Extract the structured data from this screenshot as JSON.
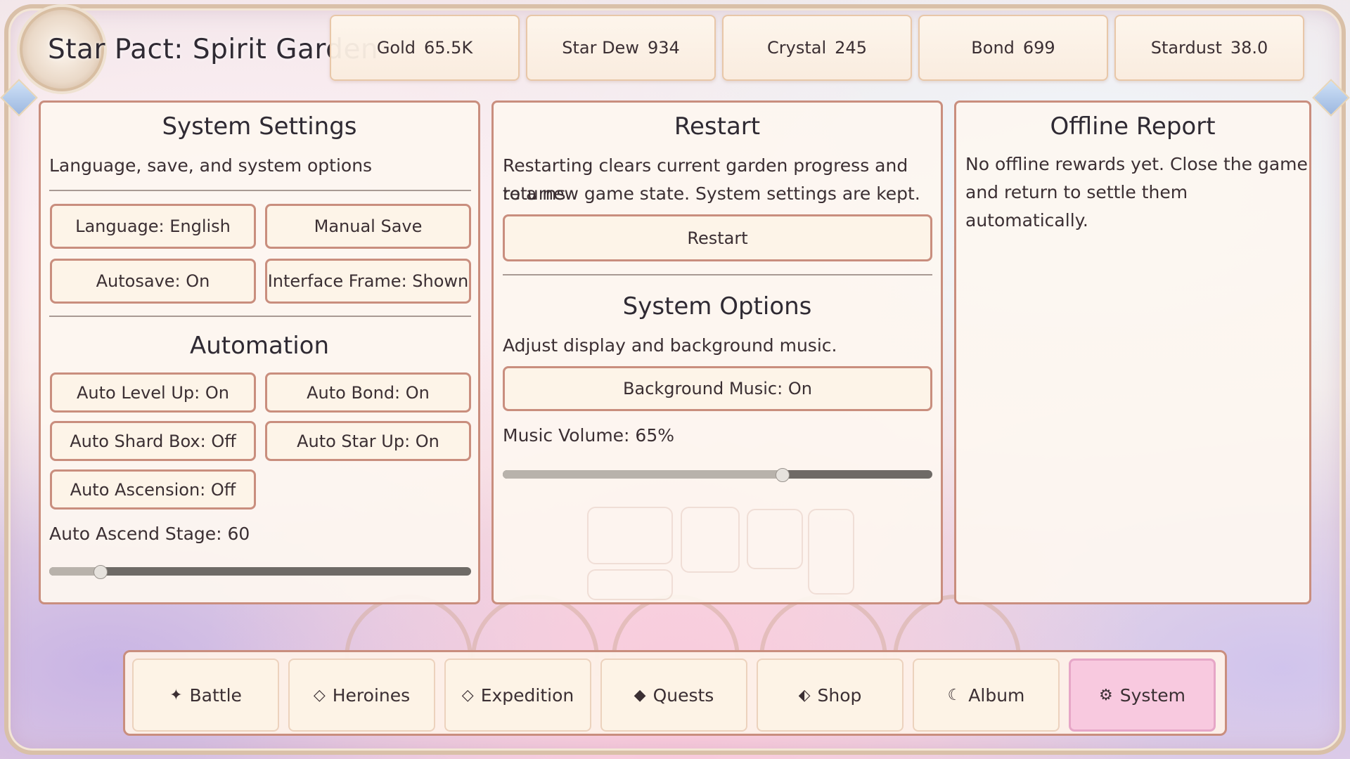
{
  "game": {
    "title": "Star Pact: Spirit Garden"
  },
  "resources": [
    {
      "label": "Gold",
      "value": "65.5K"
    },
    {
      "label": "Star Dew",
      "value": "934"
    },
    {
      "label": "Crystal",
      "value": "245"
    },
    {
      "label": "Bond",
      "value": "699"
    },
    {
      "label": "Stardust",
      "value": "38.0"
    }
  ],
  "settings": {
    "title": "System Settings",
    "subtitle": "Language, save, and system options",
    "language_btn": "Language: English",
    "manual_save_btn": "Manual Save",
    "autosave_btn": "Autosave: On",
    "interface_frame_btn": "Interface Frame: Shown",
    "automation_title": "Automation",
    "auto_level_up_btn": "Auto Level Up: On",
    "auto_bond_btn": "Auto Bond: On",
    "auto_shard_box_btn": "Auto Shard Box: Off",
    "auto_star_up_btn": "Auto Star Up: On",
    "auto_ascension_btn": "Auto Ascension: Off",
    "auto_ascend_stage_label": "Auto Ascend Stage: 60",
    "auto_ascend_stage_fraction": 0.12
  },
  "restart": {
    "title": "Restart",
    "description_line1": "Restarting clears current garden progress and returns",
    "description_line2": "to a new game state. System settings are kept.",
    "restart_btn": "Restart",
    "options_title": "System Options",
    "options_subtitle": "Adjust display and background music.",
    "bgm_btn": "Background Music: On",
    "volume_label": "Music Volume: 65%",
    "volume_fraction": 0.65
  },
  "offline": {
    "title": "Offline Report",
    "line1": "No offline rewards yet. Close the game",
    "line2": "and return to settle them automatically."
  },
  "nav": [
    {
      "icon": "✦",
      "icon_name": "sparkle-icon",
      "label": "Battle"
    },
    {
      "icon": "◇",
      "icon_name": "diamond-outline-icon",
      "label": "Heroines"
    },
    {
      "icon": "◇",
      "icon_name": "diamond-outline-icon",
      "label": "Expedition"
    },
    {
      "icon": "◆",
      "icon_name": "diamond-filled-icon",
      "label": "Quests"
    },
    {
      "icon": "⬖",
      "icon_name": "half-diamond-icon",
      "label": "Shop"
    },
    {
      "icon": "☾",
      "icon_name": "moon-icon",
      "label": "Album"
    },
    {
      "icon": "⚙",
      "icon_name": "gear-icon",
      "label": "System"
    }
  ],
  "active_nav": "System",
  "colors": {
    "panel_border": "#c98e7e",
    "active_nav_bg": "#f8c9df",
    "slider_track": "#6e6a66",
    "slider_fill": "#b8b2ab"
  }
}
